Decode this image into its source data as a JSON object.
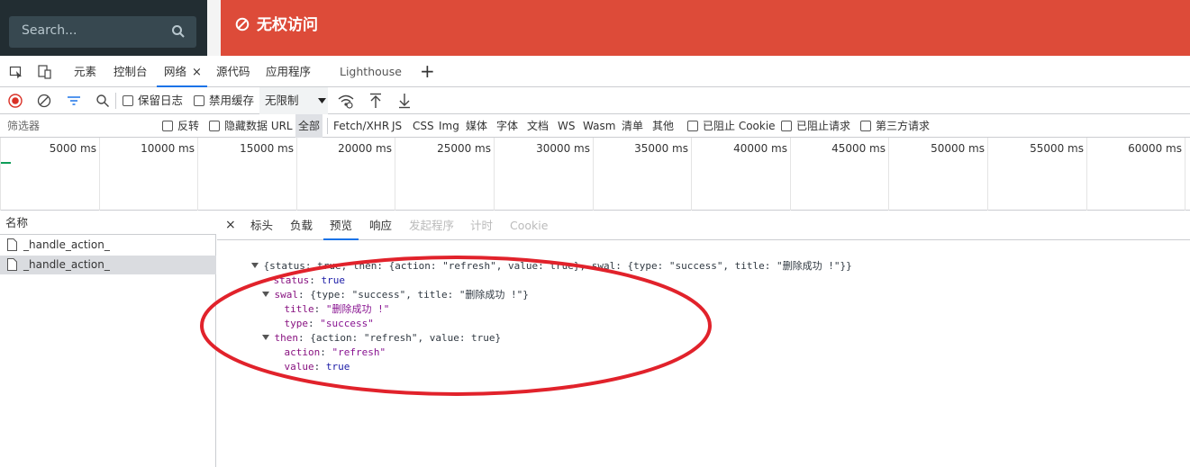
{
  "app": {
    "search_placeholder": "Search...",
    "alert_text": "无权访问",
    "colors": {
      "sidebar": "#222d32",
      "alert": "#dd4b39",
      "accent": "#1a73e8"
    }
  },
  "devtools": {
    "tabs": [
      {
        "label": "元素"
      },
      {
        "label": "控制台"
      },
      {
        "label": "网络",
        "active": true
      },
      {
        "label": "源代码"
      },
      {
        "label": "应用程序"
      },
      {
        "label": "Lighthouse"
      }
    ],
    "close_glyph": "×",
    "add_glyph": "+"
  },
  "toolbar": {
    "preserve_log": "保留日志",
    "disable_cache": "禁用缓存",
    "throttle": "无限制"
  },
  "filter": {
    "placeholder": "筛选器",
    "invert": "反转",
    "hide_data_url": "隐藏数据 URL",
    "types": [
      "全部",
      "Fetch/XHR",
      "JS",
      "CSS",
      "Img",
      "媒体",
      "字体",
      "文档",
      "WS",
      "Wasm",
      "清单",
      "其他"
    ],
    "blocked_cookies": "已阻止 Cookie",
    "blocked_requests": "已阻止请求",
    "third_party": "第三方请求"
  },
  "timeline": {
    "ticks": [
      "5000 ms",
      "10000 ms",
      "15000 ms",
      "20000 ms",
      "25000 ms",
      "30000 ms",
      "35000 ms",
      "40000 ms",
      "45000 ms",
      "50000 ms",
      "55000 ms",
      "60000 ms"
    ]
  },
  "requests": {
    "header": "名称",
    "items": [
      {
        "name": "_handle_action_"
      },
      {
        "name": "_handle_action_",
        "selected": true
      }
    ]
  },
  "detail": {
    "close_glyph": "×",
    "tabs": [
      "标头",
      "负载",
      "预览",
      "响应",
      "发起程序",
      "计时",
      "Cookie"
    ],
    "active_tab": "预览",
    "preview": {
      "summary": "{status: true, then: {action: \"refresh\", value: true}, swal: {type: \"success\", title: \"删除成功 !\"}}",
      "status_key": "status",
      "status_val": "true",
      "swal_key": "swal",
      "swal_summary": "{type: \"success\", title: \"删除成功 !\"}",
      "title_key": "title",
      "title_val": "\"删除成功 !\"",
      "type_key": "type",
      "type_val": "\"success\"",
      "then_key": "then",
      "then_summary": "{action: \"refresh\", value: true}",
      "action_key": "action",
      "action_val": "\"refresh\"",
      "value_key": "value",
      "value_val": "true"
    }
  }
}
